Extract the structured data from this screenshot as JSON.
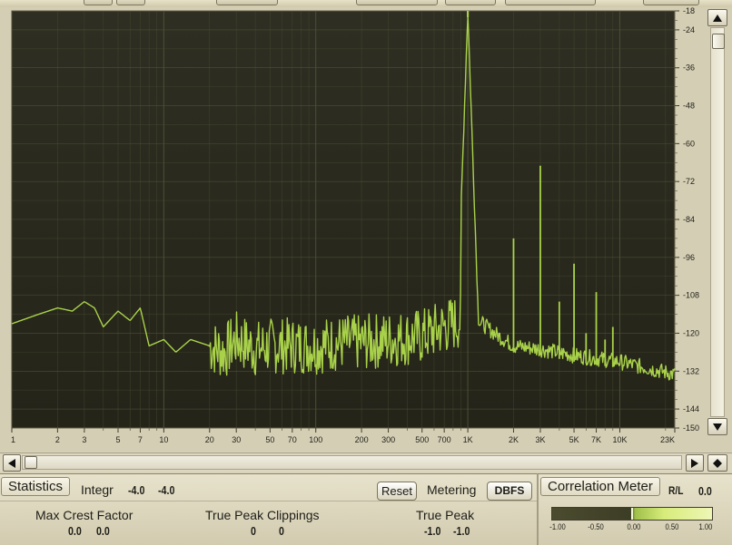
{
  "spectrum": {
    "x_ticks": [
      "1",
      "2",
      "3",
      "5",
      "7",
      "10",
      "20",
      "30",
      "50",
      "70",
      "100",
      "200",
      "300",
      "500",
      "700",
      "1K",
      "2K",
      "3K",
      "5K",
      "7K",
      "10K",
      "23K"
    ],
    "y_ticks": [
      "-18",
      "-24",
      "-36",
      "-48",
      "-60",
      "-72",
      "-84",
      "-96",
      "-108",
      "-120",
      "-132",
      "-144",
      "-150"
    ],
    "colors": {
      "background": "#2a2a1e",
      "grid": "#505036",
      "trace": "#a9d24a"
    }
  },
  "chart_data": {
    "type": "line",
    "xscale": "log",
    "xlim": [
      1,
      23000
    ],
    "ylim": [
      -150,
      -18
    ],
    "ylabel": "",
    "xlabel": "",
    "series": [
      {
        "x": [
          1,
          1.5,
          2,
          2.5,
          3,
          3.5,
          4,
          5,
          6,
          7,
          8,
          10,
          12,
          15,
          20,
          25,
          30,
          40,
          50,
          70,
          100,
          150,
          200,
          300,
          500,
          700,
          900,
          1000,
          1100,
          1500,
          2000,
          3000,
          5000,
          7000,
          10000,
          15000,
          23000
        ],
        "y": [
          -117,
          -114,
          -112,
          -113,
          -110,
          -112,
          -118,
          -113,
          -116,
          -112,
          -124,
          -122,
          -126,
          -122,
          -124,
          -126,
          -122,
          -125,
          -124,
          -124,
          -124,
          -123,
          -123,
          -122,
          -121,
          -118,
          -116,
          -18,
          -115,
          -120,
          -124,
          -125,
          -127,
          -128,
          -129,
          -131,
          -133
        ]
      }
    ],
    "harmonic_peaks": [
      {
        "x": 1000,
        "y": -18
      },
      {
        "x": 2000,
        "y": -90
      },
      {
        "x": 3000,
        "y": -67
      },
      {
        "x": 4000,
        "y": -110
      },
      {
        "x": 5000,
        "y": -98
      },
      {
        "x": 6000,
        "y": -120
      },
      {
        "x": 7000,
        "y": -107
      },
      {
        "x": 8000,
        "y": -122
      },
      {
        "x": 9000,
        "y": -118
      }
    ]
  },
  "statistics": {
    "tab_label": "Statistics",
    "integr_label": "Integr",
    "integr_left": "-4.0",
    "integr_right": "-4.0",
    "reset_label": "Reset",
    "metering_label": "Metering",
    "metering_value": "DBFS",
    "max_crest_label": "Max Crest Factor",
    "max_crest_left": "0.0",
    "max_crest_right": "0.0",
    "tp_clip_label": "True Peak Clippings",
    "tp_clip_left": "0",
    "tp_clip_right": "0",
    "true_peak_label": "True Peak",
    "true_peak_left": "-1.0",
    "true_peak_right": "-1.0"
  },
  "correlation": {
    "tab_label": "Correlation Meter",
    "rl_label": "R/L",
    "rl_value": "0.0",
    "ticks": [
      "-1.00",
      "-0.50",
      "0.00",
      "0.50",
      "1.00"
    ],
    "value": 0.0
  }
}
